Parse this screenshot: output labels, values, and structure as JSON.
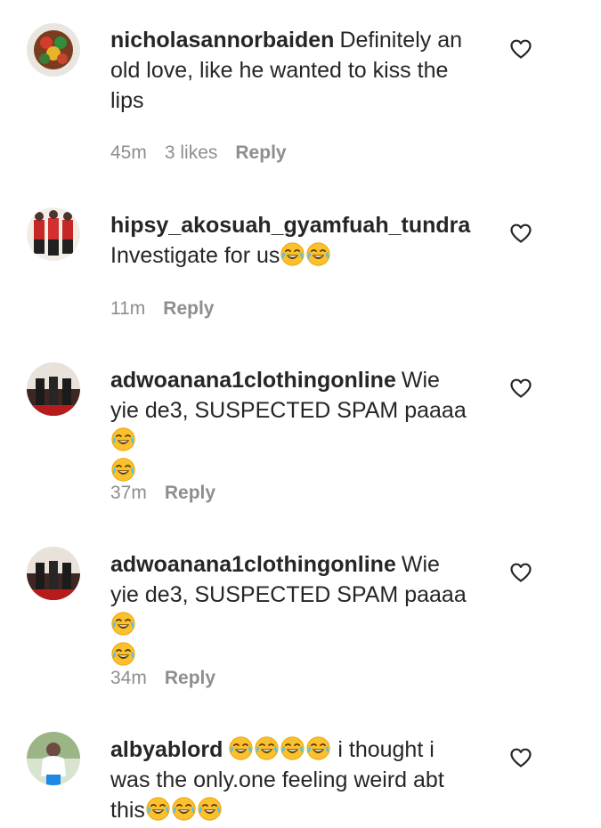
{
  "comments": [
    {
      "username": "nicholasannorbaiden",
      "text": "Definitely an old love, like he wanted to kiss the lips",
      "time": "45m",
      "likes": "3 likes",
      "reply": "Reply"
    },
    {
      "username": "hipsy_akosuah_gyamfuah_tundra",
      "text": "Investigate for us",
      "time": "11m",
      "reply": "Reply"
    },
    {
      "username": "adwoanana1clothingonline",
      "text": "Wie yie de3, SUSPECTED SPAM paaaa",
      "time": "37m",
      "reply": "Reply"
    },
    {
      "username": "adwoanana1clothingonline",
      "text": "Wie yie de3, SUSPECTED SPAM paaaa",
      "time": "34m",
      "reply": "Reply"
    },
    {
      "username": "albyablord",
      "text_after_emoji": "i thought i was the only.one feeling weird abt this",
      "text_part1": "i thought i was the only.one feeling weird abt",
      "text_part2": "this"
    }
  ],
  "icons": {
    "emoji": "face-with-tears-of-joy-icon",
    "like": "heart-outline-icon"
  },
  "colors": {
    "text": "#262626",
    "meta": "#8e8e8e",
    "emoji_face": "#FBC02D"
  }
}
